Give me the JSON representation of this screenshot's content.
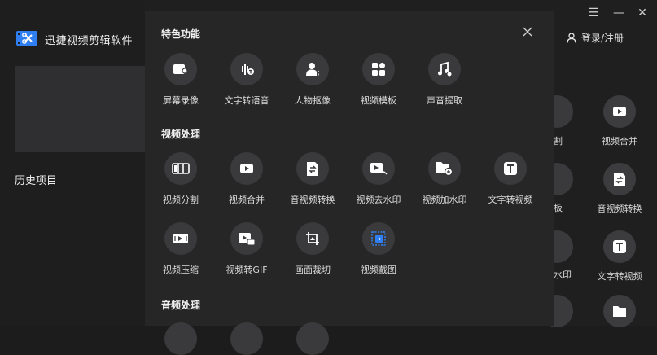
{
  "app": {
    "title": "迅捷视频剪辑软件",
    "history_label": "历史项目",
    "login_label": "登录/注册"
  },
  "window_controls": {
    "menu": "☰",
    "minimize": "—",
    "close": "✕"
  },
  "modal": {
    "sections": [
      {
        "title": "特色功能",
        "tools": [
          "屏幕录像",
          "文字转语音",
          "人物抠像",
          "视频模板",
          "声音提取"
        ]
      },
      {
        "title": "视频处理",
        "tools": [
          "视频分割",
          "视频合并",
          "音视频转换",
          "视频去水印",
          "视频加水印",
          "文字转视频",
          "视频压缩",
          "视频转GIF",
          "画面裁切",
          "视频截图"
        ]
      },
      {
        "title": "音频处理",
        "tools": []
      }
    ]
  },
  "background": {
    "fragments": [
      "割",
      "板",
      "水印"
    ],
    "items": [
      "视频合并",
      "音视频转换",
      "文字转视频"
    ]
  },
  "colors": {
    "accent": "#2f7ff2",
    "background": "#1f1f20",
    "modal": "#262627",
    "icon_circle": "#3a3a3c"
  }
}
